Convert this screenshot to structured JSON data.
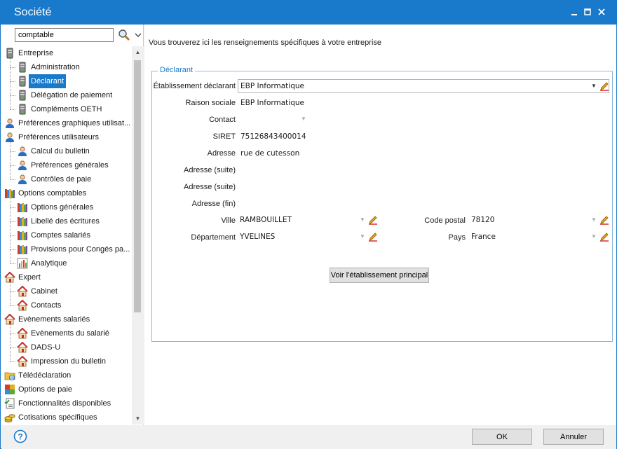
{
  "window": {
    "title": "Société"
  },
  "search": {
    "value": "comptable"
  },
  "tree": [
    {
      "label": "Entreprise",
      "icon": "server-icon"
    },
    {
      "label": "Administration",
      "icon": "server-icon"
    },
    {
      "label": "Déclarant",
      "icon": "server-icon",
      "selected": true
    },
    {
      "label": "Délégation de paiement",
      "icon": "server-icon"
    },
    {
      "label": "Compléments OETH",
      "icon": "server-icon"
    },
    {
      "label": "Préférences graphiques utilisat...",
      "icon": "user-icon"
    },
    {
      "label": "Préférences utilisateurs",
      "icon": "user-icon"
    },
    {
      "label": "Calcul du bulletin",
      "icon": "user-icon"
    },
    {
      "label": "Préférences générales",
      "icon": "user-icon"
    },
    {
      "label": "Contrôles de paie",
      "icon": "user-icon"
    },
    {
      "label": "Options comptables",
      "icon": "books-icon"
    },
    {
      "label": "Options générales",
      "icon": "books-icon"
    },
    {
      "label": "Libellé des écritures",
      "icon": "books-icon"
    },
    {
      "label": "Comptes salariés",
      "icon": "books-icon"
    },
    {
      "label": "Provisions pour Congés pa...",
      "icon": "books-icon"
    },
    {
      "label": "Analytique",
      "icon": "bar-chart-icon"
    },
    {
      "label": "Expert",
      "icon": "house-icon"
    },
    {
      "label": "Cabinet",
      "icon": "house-icon"
    },
    {
      "label": "Contacts",
      "icon": "house-icon"
    },
    {
      "label": "Evènements salariés",
      "icon": "house-icon"
    },
    {
      "label": "Evènements du salarié",
      "icon": "house-icon"
    },
    {
      "label": "DADS-U",
      "icon": "house-icon"
    },
    {
      "label": "Impression du bulletin",
      "icon": "house-icon"
    },
    {
      "label": "Télédéclaration",
      "icon": "folder-at-icon"
    },
    {
      "label": "Options de paie",
      "icon": "color-grid-icon"
    },
    {
      "label": "Fonctionnalités disponibles",
      "icon": "checklist-icon"
    },
    {
      "label": "Cotisations spécifiques",
      "icon": "coins-icon"
    }
  ],
  "main": {
    "intro": "Vous trouverez ici les renseignements spécifiques à votre entreprise",
    "group_title": "Déclarant",
    "labels": {
      "etablissement": "Établissement déclarant",
      "raison_sociale": "Raison sociale",
      "contact": "Contact",
      "siret": "SIRET",
      "adresse": "Adresse",
      "adresse_suite1": "Adresse (suite)",
      "adresse_suite2": "Adresse (suite)",
      "adresse_fin": "Adresse (fin)",
      "ville": "Ville",
      "code_postal": "Code postal",
      "departement": "Département",
      "pays": "Pays"
    },
    "values": {
      "etablissement": "EBP Informatique",
      "raison_sociale": "EBP Informatique",
      "contact": "",
      "siret": "75126843400014",
      "adresse": "rue de cutesson",
      "adresse_suite1": "",
      "adresse_suite2": "",
      "adresse_fin": "",
      "ville": "RAMBOUILLET",
      "code_postal": "78120",
      "departement": "YVELINES",
      "pays": "France"
    },
    "button_principal": "Voir l'établissement principal"
  },
  "footer": {
    "ok": "OK",
    "cancel": "Annuler"
  },
  "colors": {
    "accent": "#1979ca",
    "selection": "#1979ca"
  }
}
